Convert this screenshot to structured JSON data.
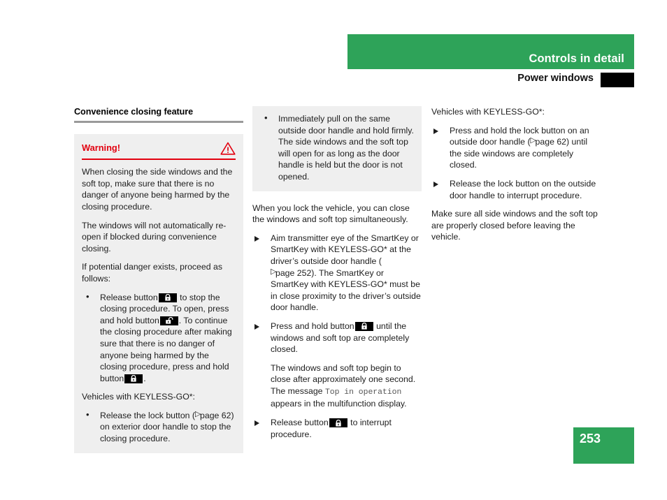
{
  "header": {
    "chapter": "Controls in detail",
    "section": "Power windows",
    "band_color": "#2ea359",
    "tab_color": "#000000"
  },
  "footer": {
    "page_number": "253",
    "color": "#2ea359"
  },
  "left_column": {
    "heading": "Convenience closing feature",
    "warning": {
      "title": "Warning!",
      "accent_color": "#e2000f",
      "icon": "warning-triangle-icon",
      "paragraphs": [
        "When closing the side windows and the soft top, make sure that there is no danger of anyone being harmed by the closing procedure.",
        "The windows will not automatically re-open if blocked during convenience closing.",
        "If potential danger exists, proceed as follows:"
      ],
      "bullet1_part1": "Release button",
      "bullet1_part2": "to stop the closing procedure. To open, press and hold button",
      "bullet1_part3": ". To continue the closing procedure after making sure that there is no danger of anyone being harmed by the closing procedure, press and hold button",
      "bullet1_part4": ".",
      "keyless_lead": "Vehicles with KEYLESS-GO*:",
      "bullet2_part1": "Release the lock button (",
      "bullet2_ref": "page 62",
      "bullet2_part2": ") on exterior door handle to stop the closing procedure."
    }
  },
  "middle_column": {
    "gray_bullet": "Immediately pull on the same outside door handle and hold firmly. The side windows and the soft top will open for as long as the door handle is held but the door is not opened.",
    "intro": "When you lock the vehicle, you can close the windows and soft top simultaneously.",
    "step1_part1": "Aim transmitter eye of the SmartKey or SmartKey with KEYLESS-GO* at the driver’s outside door handle (",
    "step1_ref": "page 252",
    "step1_part2": "). The SmartKey or SmartKey with KEYLESS-GO* must be in close proximity to the driver’s outside door handle.",
    "step2_part1": "Press and hold button",
    "step2_part2": "until the windows and soft top are completely closed.",
    "step2_sub_part1": "The windows and soft top begin to close after approximately one second. The message",
    "step2_sub_message": "Top in operation",
    "step2_sub_part2": "appears in the multifunction display.",
    "step3_part1": "Release button",
    "step3_part2": "to interrupt procedure."
  },
  "right_column": {
    "lead": "Vehicles with KEYLESS-GO*:",
    "step1_part1": "Press and hold the lock button on an outside door handle (",
    "step1_ref": "page 62",
    "step1_part2": ") until the side windows are completely closed.",
    "step2": "Release the lock button on the outside door handle to interrupt procedure.",
    "closing": "Make sure all side windows and the soft top are properly closed before leaving the vehicle."
  },
  "icons": {
    "lock_closed": "lock-closed-icon",
    "lock_open": "lock-open-icon",
    "warning": "warning-triangle-icon",
    "cross_reference": "cross-reference-arrow-icon"
  }
}
